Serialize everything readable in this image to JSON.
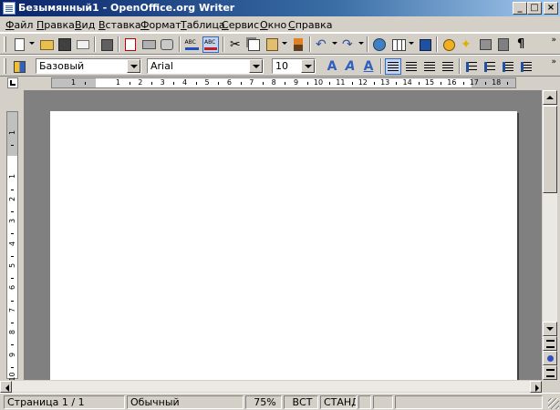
{
  "window": {
    "title": "Безымянный1 - OpenOffice.org Writer",
    "buttons": {
      "minimize": "_",
      "maximize": "□",
      "close": "×"
    }
  },
  "menu": {
    "items": [
      "Файл",
      "Правка",
      "Вид",
      "Вставка",
      "Формат",
      "Таблица",
      "Сервис",
      "Окно",
      "Справка"
    ]
  },
  "standard_toolbar": {
    "icons": [
      "new-document-icon",
      "open-icon",
      "save-icon",
      "send-mail-icon",
      "edit-file-icon",
      "export-pdf-icon",
      "print-icon",
      "print-preview-icon",
      "spellcheck-icon",
      "autospellcheck-icon",
      "cut-icon",
      "copy-icon",
      "paste-icon",
      "format-paintbrush-icon",
      "undo-icon",
      "redo-icon",
      "hyperlink-icon",
      "table-icon",
      "show-draw-functions-icon",
      "navigator-icon",
      "gallery-icon",
      "data-sources-icon",
      "formatting-marks-icon"
    ],
    "overflow": "»"
  },
  "formatting_toolbar": {
    "paragraph_style": "Базовый",
    "font_name": "Arial",
    "font_size": "10",
    "icons": [
      "styles-and-formatting-icon",
      "bold-icon",
      "italic-icon",
      "underline-icon",
      "align-left-icon",
      "align-center-icon",
      "align-right-icon",
      "justify-icon",
      "numbering-icon",
      "bullets-icon",
      "decrease-indent-icon",
      "increase-indent-icon"
    ],
    "overflow": "»"
  },
  "rulers": {
    "horizontal_numbers": [
      "1",
      "1",
      "2",
      "3",
      "4",
      "5",
      "6",
      "7",
      "8",
      "9",
      "10",
      "11",
      "12",
      "13",
      "14",
      "15",
      "16",
      "17",
      "18"
    ],
    "vertical_numbers": [
      "1",
      "1",
      "2",
      "3",
      "4",
      "5",
      "6",
      "7",
      "8",
      "9",
      "10"
    ]
  },
  "statusbar": {
    "page": "Страница  1 / 1",
    "style": "Обычный",
    "zoom": "75%",
    "insert_mode": "ВСТ",
    "selection_mode": "СТАНД"
  },
  "colors": {
    "title_gradient_start": "#0a246a",
    "title_gradient_end": "#a6caf0",
    "workspace": "#808080",
    "chrome": "#d4d0c8"
  }
}
